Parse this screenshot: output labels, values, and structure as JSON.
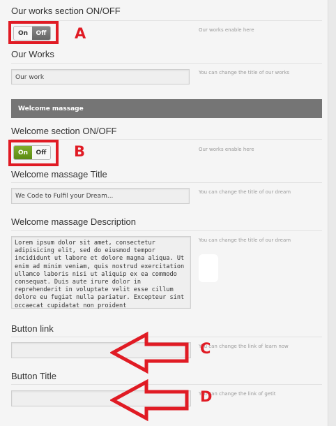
{
  "sections": {
    "our_works_toggle": {
      "label": "Our works section ON/OFF",
      "on_label": "On",
      "off_label": "Off",
      "state": "off",
      "help": "Our works enable here"
    },
    "our_works_title": {
      "label": "Our Works",
      "value": "Our work",
      "help": "You can change the title of our works"
    },
    "welcome_bar": {
      "title": "Welcome massage"
    },
    "welcome_toggle": {
      "label": "Welcome section ON/OFF",
      "on_label": "On",
      "off_label": "Off",
      "state": "on",
      "help": "Our works enable here"
    },
    "welcome_title": {
      "label": "Welcome massage Title",
      "value": "We Code to Fulfil your Dream...",
      "help": "You can change the title of our dream"
    },
    "welcome_description": {
      "label": "Welcome massage Description",
      "value": "Lorem ipsum dolor sit amet, consectetur adipisicing elit, sed do eiusmod tempor incididunt ut labore et dolore magna aliqua. Ut enim ad minim veniam, quis nostrud exercitation ullamco laboris nisi ut aliquip ex ea commodo consequat. Duis aute irure dolor in reprehenderit in voluptate velit esse cillum dolore eu fugiat nulla pariatur. Excepteur sint occaecat cupidatat non proident",
      "help": "You can change the title of our dream"
    },
    "button_link": {
      "label": "Button link",
      "value": "",
      "help": "You can change the link of learn now"
    },
    "button_title": {
      "label": "Button Title",
      "value": "",
      "help": "You can change the link of getit"
    }
  },
  "annotations": {
    "a": "A",
    "b": "B",
    "c": "C",
    "d": "D"
  },
  "colors": {
    "annotation_red": "#e01b24",
    "toggle_on_green": "#6a9a1c",
    "toggle_off_gray": "#707070",
    "section_bar": "#757575"
  }
}
